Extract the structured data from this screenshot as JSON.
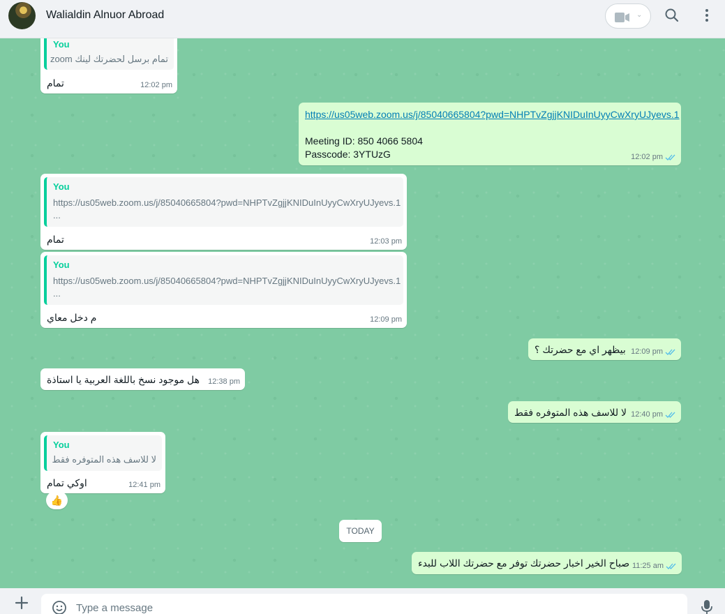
{
  "header": {
    "contact_name": "Walialdin Alnuor Abroad",
    "icons": [
      "video-call-icon",
      "chevron-down-icon",
      "search-icon",
      "menu-icon"
    ]
  },
  "messages": [
    {
      "dir": "in",
      "quote_author": "You",
      "quote_text": "تمام برسل لحضرتك لينك zoom",
      "text": "تمام",
      "time": "12:02 pm"
    },
    {
      "dir": "out",
      "link": "https://us05web.zoom.us/j/85040665804?pwd=NHPTvZgjjKNIDuInUyyCwXryUJyevs.1",
      "line1": "Meeting ID: 850 4066 5804",
      "line2": "Passcode: 3YTUzG",
      "time": "12:02 pm"
    },
    {
      "dir": "in",
      "quote_author": "You",
      "quote_text": "https://us05web.zoom.us/j/85040665804?pwd=NHPTvZgjjKNIDuInUyyCwXryUJyevs.1",
      "quote_more": "...",
      "text": "تمام",
      "time": "12:03 pm"
    },
    {
      "dir": "in",
      "quote_author": "You",
      "quote_text": "https://us05web.zoom.us/j/85040665804?pwd=NHPTvZgjjKNIDuInUyyCwXryUJyevs.1",
      "quote_more": "...",
      "text": "م دخل معاي",
      "time": "12:09 pm"
    },
    {
      "dir": "out",
      "text": "بيظهر اي مع حضرتك ؟",
      "time": "12:09 pm"
    },
    {
      "dir": "in",
      "text": "هل موجود نسخ باللغة العربية يا استاذة",
      "time": "12:38 pm"
    },
    {
      "dir": "out",
      "text": "لا للاسف هذه المتوفره فقط",
      "time": "12:40 pm"
    },
    {
      "dir": "in",
      "quote_author": "You",
      "quote_text": "لا للاسف هذه المتوفره فقط",
      "text": "اوكي تمام",
      "time": "12:41 pm",
      "reaction": "👍"
    },
    {
      "dir": "out",
      "text": "صباح الخير اخبار حضرتك توفر مع حضرتك اللاب للبدء",
      "time": "11:25 am"
    }
  ],
  "divider": {
    "today": "TODAY"
  },
  "composer": {
    "placeholder": "Type a message"
  },
  "colors": {
    "header_bg": "#f0f2f5",
    "chat_bg": "#7fcba3",
    "outgoing_bubble": "#d9fdd3",
    "incoming_bubble": "#ffffff",
    "quote_accent": "#06cf9c",
    "read_ticks": "#53bdeb",
    "link": "#027eb5"
  }
}
